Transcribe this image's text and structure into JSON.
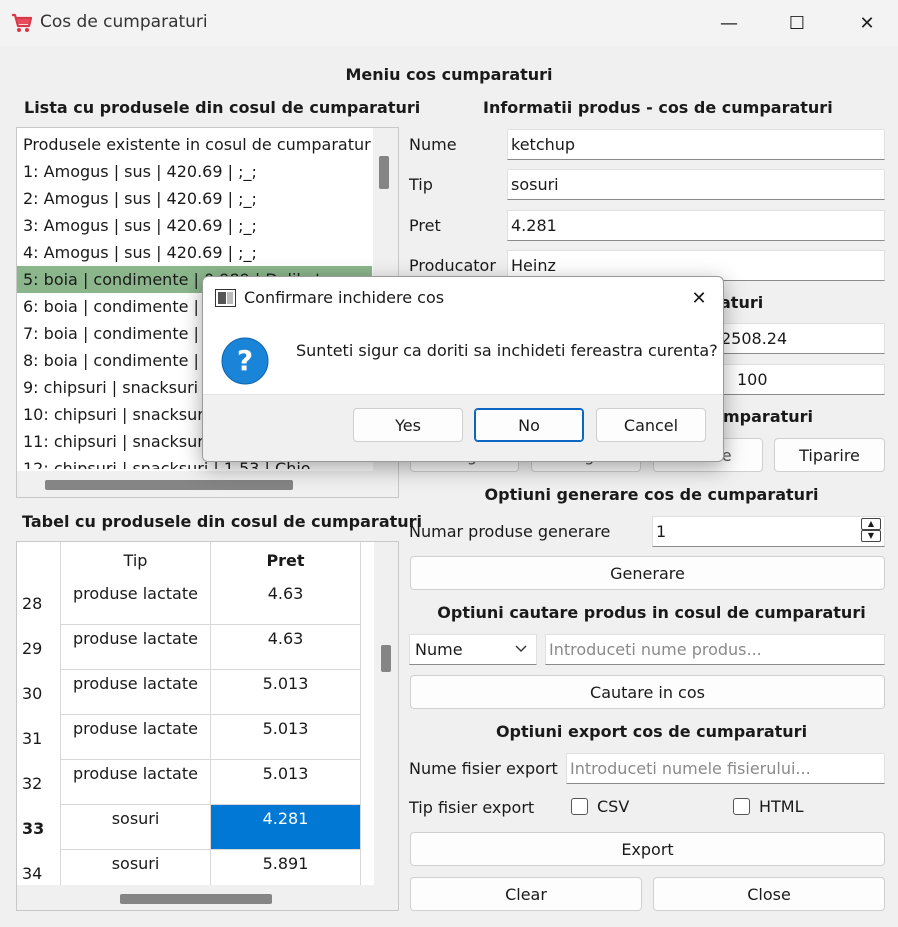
{
  "window": {
    "title": "Cos de cumparaturi",
    "controls": {
      "minimize": "—",
      "maximize": "☐",
      "close": "✕"
    }
  },
  "main_title": "Meniu cos cumparaturi",
  "list_section": {
    "title": "Lista cu produsele din cosul de cumparaturi",
    "items": [
      "Produsele existente in cosul de cumparaturi",
      "1: Amogus | sus | 420.69 | ;_;",
      "2: Amogus | sus | 420.69 | ;_;",
      "3: Amogus | sus | 420.69 | ;_;",
      "4: Amogus | sus | 420.69 | ;_;",
      "5: boia | condimente | 0.989 | Delikat",
      "6: boia | condimente | 0",
      "7: boia | condimente | 0",
      "8: boia | condimente | 0",
      "9: chipsuri | snacksuri | 1",
      "10: chipsuri | snacksuri",
      "11: chipsuri | snacksuri",
      "12: chipsuri | snacksuri | 1.53 | Chio"
    ],
    "selected_index": 5
  },
  "product_info": {
    "title": "Informatii produs - cos de cumparaturi",
    "fields": [
      {
        "label": "Nume",
        "value": "ketchup"
      },
      {
        "label": "Tip",
        "value": "sosuri"
      },
      {
        "label": "Pret",
        "value": "4.281"
      },
      {
        "label": "Producator",
        "value": "Heinz"
      }
    ]
  },
  "hidden_section": {
    "title_fragment": "aturi",
    "value1": "2508.24",
    "value2": "100"
  },
  "operations": {
    "title_fragment": "mparaturi",
    "buttons": [
      "Adaugare",
      "Stergere",
      "Golire",
      "Tiparire"
    ]
  },
  "generate": {
    "title": "Optiuni generare cos de cumparaturi",
    "label": "Numar produse generare",
    "value": "1",
    "button": "Generare"
  },
  "search": {
    "title": "Optiuni cautare produs in cosul de cumparaturi",
    "select_value": "Nume",
    "placeholder": "Introduceti nume produs...",
    "button": "Cautare in cos"
  },
  "export": {
    "title": "Optiuni export cos de cumparaturi",
    "name_label": "Nume fisier export",
    "name_placeholder": "Introduceti numele fisierului...",
    "type_label": "Tip fisier export",
    "csv_label": "CSV",
    "html_label": "HTML",
    "button": "Export"
  },
  "bottom_buttons": {
    "clear": "Clear",
    "close": "Close"
  },
  "table_section": {
    "title": "Tabel cu produsele din cosul de cumparaturi",
    "headers": {
      "tip": "Tip",
      "pret": "Pret"
    },
    "rows": [
      {
        "num": "28",
        "tip": "produse lactate",
        "pret": "4.63"
      },
      {
        "num": "29",
        "tip": "produse lactate",
        "pret": "4.63"
      },
      {
        "num": "30",
        "tip": "produse lactate",
        "pret": "5.013"
      },
      {
        "num": "31",
        "tip": "produse lactate",
        "pret": "5.013"
      },
      {
        "num": "32",
        "tip": "produse lactate",
        "pret": "5.013"
      },
      {
        "num": "33",
        "tip": "sosuri",
        "pret": "4.281"
      },
      {
        "num": "34",
        "tip": "sosuri",
        "pret": "5.891"
      }
    ],
    "selected_row": 5
  },
  "dialog": {
    "title": "Confirmare inchidere cos",
    "message": "Sunteti sigur ca doriti sa inchideti fereastra curenta?",
    "buttons": {
      "yes": "Yes",
      "no": "No",
      "cancel": "Cancel"
    },
    "close": "✕"
  },
  "colors": {
    "selection_green": "#8bb68b",
    "selection_blue": "#0078d4",
    "dialog_icon": "#1a84d8"
  }
}
